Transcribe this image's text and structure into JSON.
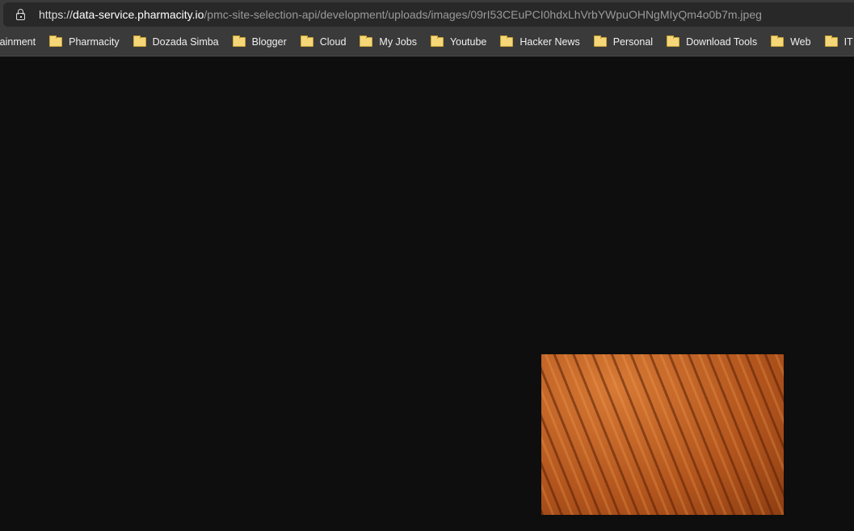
{
  "address_bar": {
    "scheme": "https://",
    "host": "data-service.pharmacity.io",
    "path": "/pmc-site-selection-api/development/uploads/images/09rI53CEuPCI0hdxLhVrbYWpuOHNgMIyQm4o0b7m.jpeg"
  },
  "bookmarks": [
    "rtainment",
    "Pharmacity",
    "Dozada Simba",
    "Blogger",
    "Cloud",
    "My Jobs",
    "Youtube",
    "Hacker News",
    "Personal",
    "Download Tools",
    "Web",
    "IT"
  ],
  "colors": {
    "page_bg": "#0e0e0e",
    "toolbar": "#3a3a3a",
    "folder": "#f5d77a"
  }
}
